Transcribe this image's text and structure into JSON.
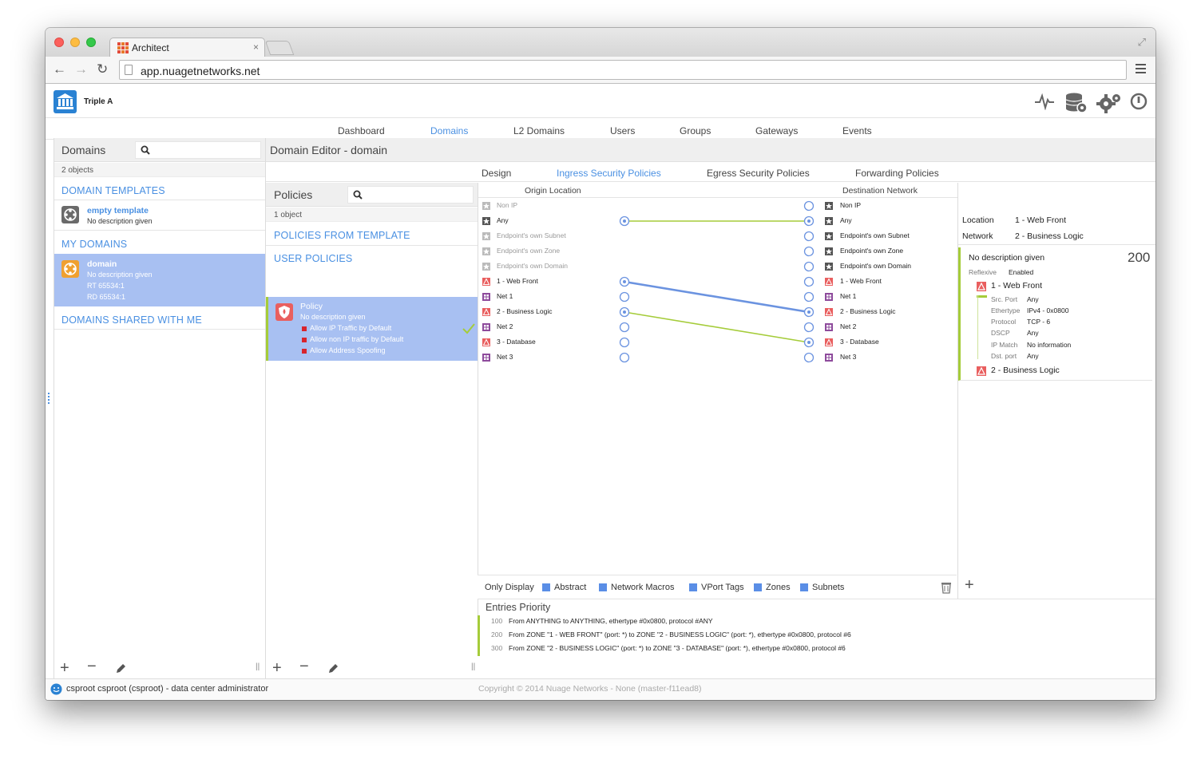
{
  "browser": {
    "tab_title": "Architect",
    "tab_close": "×",
    "url": "app.nuagetnetworks.net"
  },
  "app": {
    "org_name": "Triple A"
  },
  "main_nav": [
    "Dashboard",
    "Domains",
    "L2 Domains",
    "Users",
    "Groups",
    "Gateways",
    "Events"
  ],
  "domains_panel": {
    "title": "Domains",
    "count": "2 objects",
    "templates_title": "DOMAIN TEMPLATES",
    "template": {
      "name": "empty template",
      "description": "No description given"
    },
    "my_domains_title": "MY DOMAINS",
    "domain": {
      "name": "domain",
      "description": "No description given",
      "rt": "RT   65534:1",
      "rd": "RD   65534:1"
    },
    "shared_title": "DOMAINS SHARED WITH ME"
  },
  "editor": {
    "title": "Domain Editor - domain",
    "tabs": [
      "Design",
      "Ingress Security Policies",
      "Egress Security Policies",
      "Forwarding Policies"
    ]
  },
  "policies_panel": {
    "title": "Policies",
    "count": "1 object",
    "from_template_title": "POLICIES FROM TEMPLATE",
    "user_title": "USER POLICIES",
    "policy": {
      "name": "Policy",
      "description": "No description given",
      "flags": [
        "Allow IP Traffic by Default",
        "Allow non IP traffic by Default",
        "Allow Address Spoofing"
      ]
    }
  },
  "graph": {
    "origin_header": "Origin Location",
    "destination_header": "Destination Network",
    "origin_nodes": [
      {
        "label": "Non IP",
        "kind": "star",
        "muted": true
      },
      {
        "label": "Any",
        "kind": "star",
        "muted": false
      },
      {
        "label": "Endpoint's own Subnet",
        "kind": "star",
        "muted": true
      },
      {
        "label": "Endpoint's own Zone",
        "kind": "star",
        "muted": true
      },
      {
        "label": "Endpoint's own Domain",
        "kind": "star",
        "muted": true
      },
      {
        "label": "1 - Web Front",
        "kind": "zone",
        "muted": false
      },
      {
        "label": "Net 1",
        "kind": "subnet",
        "muted": false
      },
      {
        "label": "2 - Business Logic",
        "kind": "zone",
        "muted": false
      },
      {
        "label": "Net 2",
        "kind": "subnet",
        "muted": false
      },
      {
        "label": "3 - Database",
        "kind": "zone",
        "muted": false
      },
      {
        "label": "Net 3",
        "kind": "subnet",
        "muted": false
      }
    ],
    "destination_nodes": [
      {
        "label": "Non IP",
        "kind": "star"
      },
      {
        "label": "Any",
        "kind": "star"
      },
      {
        "label": "Endpoint's own Subnet",
        "kind": "star"
      },
      {
        "label": "Endpoint's own Zone",
        "kind": "star"
      },
      {
        "label": "Endpoint's own Domain",
        "kind": "star"
      },
      {
        "label": "1 - Web Front",
        "kind": "zone"
      },
      {
        "label": "Net 1",
        "kind": "subnet"
      },
      {
        "label": "2 - Business Logic",
        "kind": "zone"
      },
      {
        "label": "Net 2",
        "kind": "subnet"
      },
      {
        "label": "3 - Database",
        "kind": "zone"
      },
      {
        "label": "Net 3",
        "kind": "subnet"
      }
    ],
    "links": [
      {
        "from": 1,
        "to": 1,
        "color": "#a5cc3a"
      },
      {
        "from": 5,
        "to": 7,
        "color": "#6b93e0",
        "selected": true
      },
      {
        "from": 7,
        "to": 9,
        "color": "#a5cc3a"
      }
    ]
  },
  "filters": {
    "label": "Only Display",
    "items": [
      "Abstract",
      "Network Macros",
      "VPort Tags",
      "Zones",
      "Subnets"
    ]
  },
  "entries": {
    "title": "Entries Priority",
    "rows": [
      {
        "priority": "100",
        "text": "From ANYTHING to ANYTHING, ethertype #0x0800, protocol #ANY"
      },
      {
        "priority": "200",
        "text": "From ZONE \"1 - WEB FRONT\" (port: *) to ZONE \"2 - BUSINESS LOGIC\" (port: *), ethertype #0x0800, protocol #6"
      },
      {
        "priority": "300",
        "text": "From ZONE \"2 - BUSINESS LOGIC\" (port: *) to ZONE \"3 - DATABASE\" (port: *), ethertype #0x0800, protocol #6"
      }
    ]
  },
  "detail": {
    "location_key": "Location",
    "location_val": "1 - Web Front",
    "network_key": "Network",
    "network_val": "2 - Business Logic",
    "description": "No description given",
    "priority": "200",
    "reflexive_key": "Reflexive",
    "reflexive_val": "Enabled",
    "source": "1 - Web Front",
    "props": [
      {
        "k": "Src. Port",
        "v": "Any"
      },
      {
        "k": "Ethertype",
        "v": "IPv4 - 0x0800"
      },
      {
        "k": "Protocol",
        "v": "TCP - 6"
      },
      {
        "k": "DSCP",
        "v": "Any"
      },
      {
        "k": "IP Match",
        "v": "No information"
      },
      {
        "k": "Dst. port",
        "v": "Any"
      }
    ],
    "destination": "2 - Business Logic"
  },
  "statusbar": {
    "user": "csproot csproot (csproot) - data center administrator",
    "copyright": "Copyright © 2014 Nuage Networks - None (master-f11ead8)"
  },
  "colors": {
    "accent": "#4a90e2",
    "selection": "#a8c0f2",
    "green": "#a5cc3a",
    "zone_red": "#e95f5f",
    "subnet_purple": "#8e4b9c"
  }
}
